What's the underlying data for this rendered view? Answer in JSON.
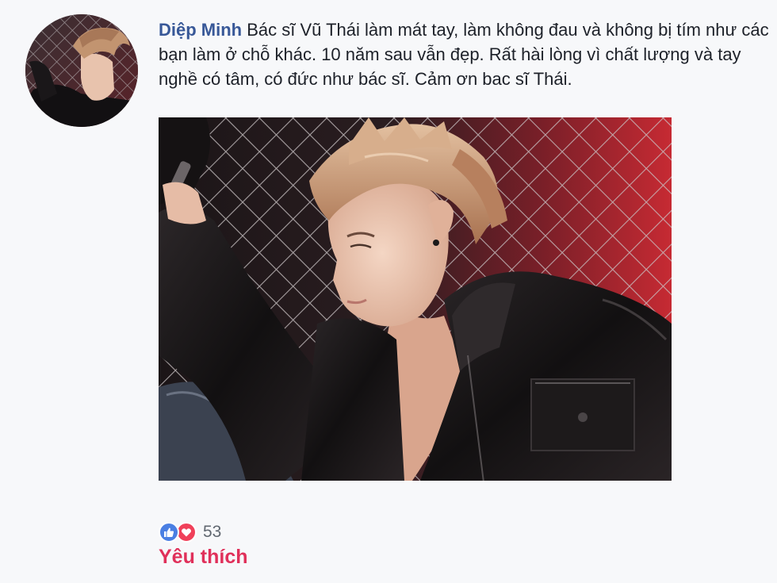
{
  "comment": {
    "author": "Diệp Minh",
    "text": "Bác sĩ Vũ Thái làm mát tay, làm không đau và không bị tím như các bạn làm ở chỗ khác. 10 năm sau vẫn đẹp. Rất hài lòng vì chất lượng và tay nghề có tâm, có đức như bác sĩ. Cảm ơn bac sĩ Thái."
  },
  "reactions": {
    "icons": [
      "like-icon",
      "love-icon"
    ],
    "count": "53",
    "label": "Yêu thích",
    "colors": {
      "like": "#4a7fe3",
      "love": "#f0405a",
      "label": "#e0305a",
      "author": "#385898"
    }
  }
}
